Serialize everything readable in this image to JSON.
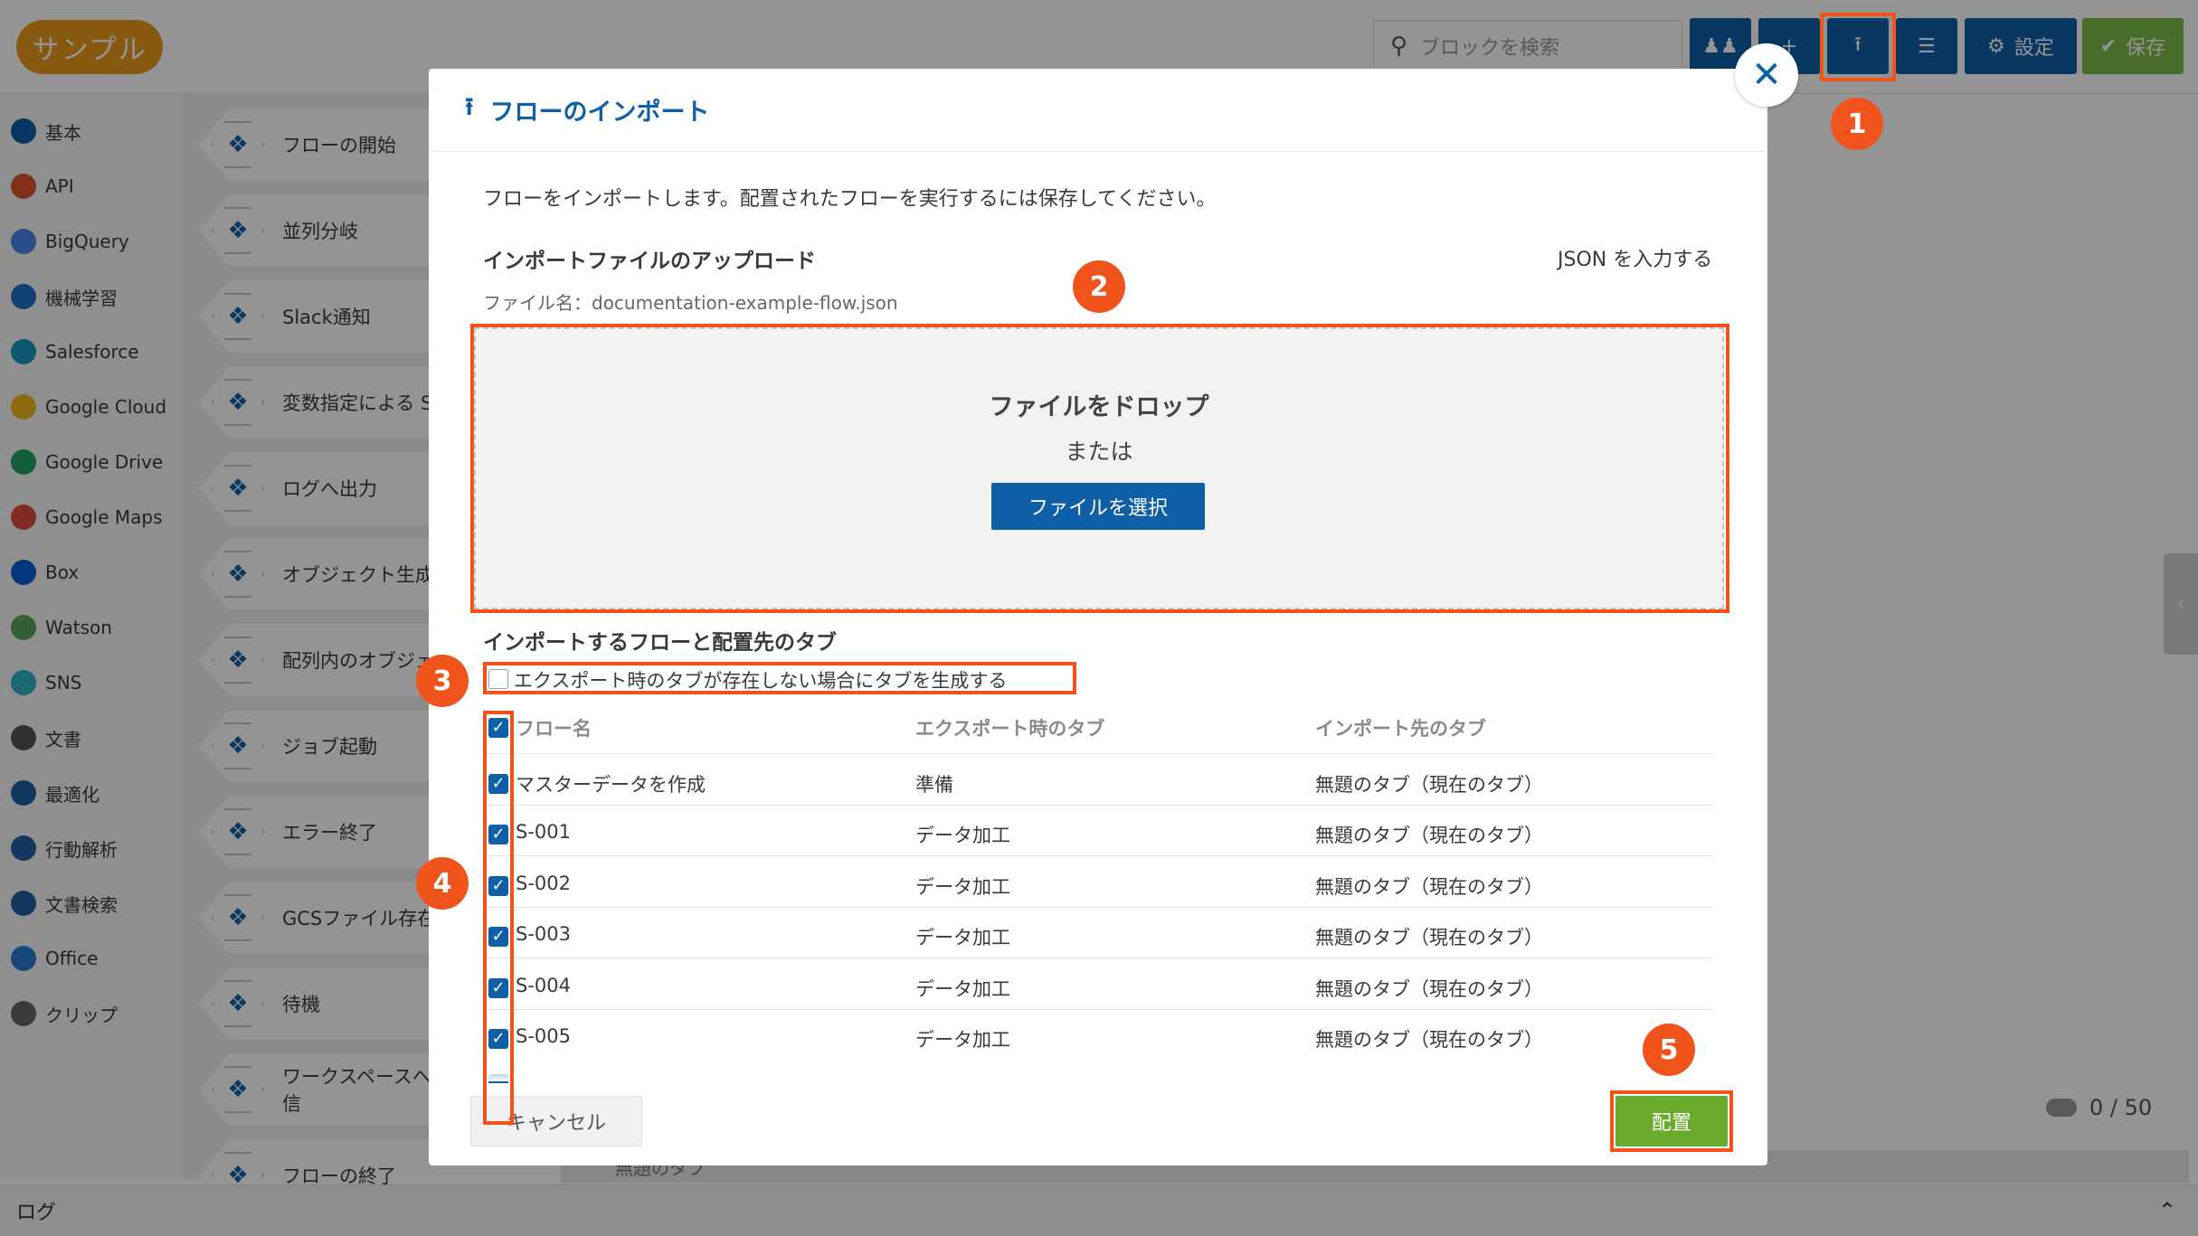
{
  "app": {
    "logo": "サンプル"
  },
  "toolbar": {
    "search_placeholder": "ブロックを検索",
    "settings_label": "設定",
    "save_label": "保存"
  },
  "sidebar": {
    "items": [
      {
        "label": "基本",
        "color": "#0f5fa7"
      },
      {
        "label": "API",
        "color": "#e0532b"
      },
      {
        "label": "BigQuery",
        "color": "#4a86e8"
      },
      {
        "label": "機械学習",
        "color": "#1f72c9"
      },
      {
        "label": "Salesforce",
        "color": "#1798c1"
      },
      {
        "label": "Google Cloud",
        "color": "#f2b81a"
      },
      {
        "label": "Google Drive",
        "color": "#1ea362"
      },
      {
        "label": "Google Maps",
        "color": "#dd4b3e"
      },
      {
        "label": "Box",
        "color": "#0061d5"
      },
      {
        "label": "Watson",
        "color": "#5aa45a"
      },
      {
        "label": "SNS",
        "color": "#2bb3c9"
      },
      {
        "label": "文書",
        "color": "#555555"
      },
      {
        "label": "最適化",
        "color": "#1f5fa8"
      },
      {
        "label": "行動解析",
        "color": "#1f5fa8"
      },
      {
        "label": "文書検索",
        "color": "#1f5fa8"
      },
      {
        "label": "Office",
        "color": "#2b7cd3"
      },
      {
        "label": "クリップ",
        "color": "#666666"
      }
    ]
  },
  "palette": {
    "items": [
      "フローの開始",
      "並列分岐",
      "Slack通知",
      "変数指定による S",
      "ログへ出力",
      "オブジェクト生成",
      "配列内のオブジェ 変換",
      "ジョブ起動",
      "エラー終了",
      "GCSファイル存在",
      "待機",
      "ワークスペースへ ジを送信",
      "フローの終了"
    ]
  },
  "canvas": {
    "counter": "0 / 50",
    "tab_label": "無題のタブ"
  },
  "bottom": {
    "log_label": "ログ"
  },
  "modal": {
    "title": "フローのインポート",
    "description": "フローをインポートします。配置されたフローを実行するには保存してください。",
    "upload_heading": "インポートファイルのアップロード",
    "json_link": "JSON を入力する",
    "file_name": "ファイル名：documentation-example-flow.json",
    "drop_title": "ファイルをドロップ",
    "drop_or": "または",
    "select_file_button": "ファイルを選択",
    "flows_heading": "インポートするフローと配置先のタブ",
    "create_tab_option": "エクスポート時のタブが存在しない場合にタブを生成する",
    "columns": [
      "フロー名",
      "エクスポート時のタブ",
      "インポート先のタブ"
    ],
    "rows": [
      {
        "name": "マスターデータを作成",
        "export_tab": "準備",
        "import_tab": "無題のタブ（現在のタブ）"
      },
      {
        "name": "S-001",
        "export_tab": "データ加工",
        "import_tab": "無題のタブ（現在のタブ）"
      },
      {
        "name": "S-002",
        "export_tab": "データ加工",
        "import_tab": "無題のタブ（現在のタブ）"
      },
      {
        "name": "S-003",
        "export_tab": "データ加工",
        "import_tab": "無題のタブ（現在のタブ）"
      },
      {
        "name": "S-004",
        "export_tab": "データ加工",
        "import_tab": "無題のタブ（現在のタブ）"
      },
      {
        "name": "S-005",
        "export_tab": "データ加工",
        "import_tab": "無題のタブ（現在のタブ）"
      }
    ],
    "cancel_button": "キャンセル",
    "deploy_button": "配置"
  },
  "annotations": [
    "1",
    "2",
    "3",
    "4",
    "5"
  ],
  "colors": {
    "accent": "#0f5fa7",
    "annotation": "#f0541c",
    "deploy": "#6aab2e",
    "logo": "#ea9c1e"
  }
}
